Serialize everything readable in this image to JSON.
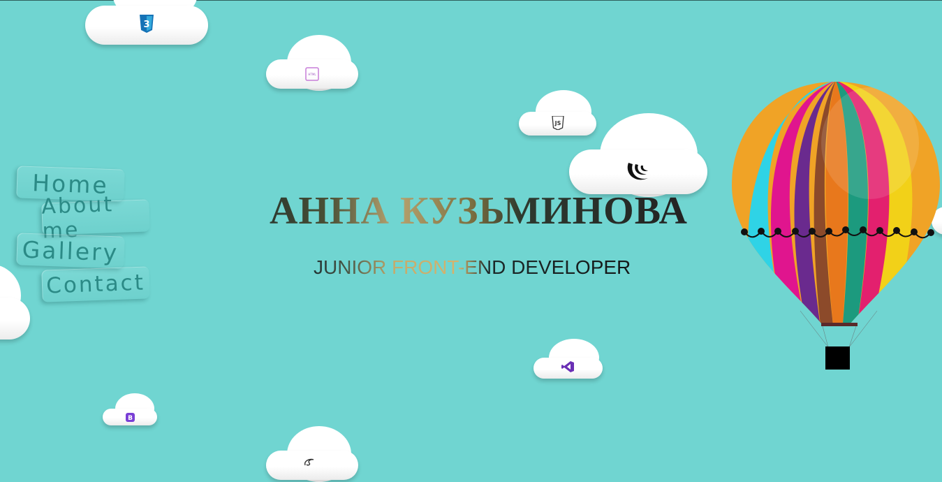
{
  "nav": {
    "items": [
      {
        "label": "Home"
      },
      {
        "label": "About me"
      },
      {
        "label": "Gallery"
      },
      {
        "label": "Contact"
      }
    ]
  },
  "hero": {
    "name": "АННА КУЗЬМИНОВА",
    "subtitle": "JUNIOR FRONT-END DEVELOPER"
  },
  "clouds": [
    {
      "icon": "css3-icon",
      "label": "3"
    },
    {
      "icon": "html5-icon",
      "label": "HTML"
    },
    {
      "icon": "js-icon",
      "label": "JS"
    },
    {
      "icon": "jquery-icon",
      "label": ""
    },
    {
      "icon": "visual-studio-icon",
      "label": ""
    },
    {
      "icon": "bootstrap-icon",
      "label": "B"
    },
    {
      "icon": "sass-icon",
      "label": ""
    }
  ],
  "colors": {
    "background": "#70d5d1",
    "nav_text": "#2b8a86",
    "bootstrap": "#7a3fd6",
    "css3": "#1572b6",
    "visual_studio": "#6a2fb5"
  }
}
